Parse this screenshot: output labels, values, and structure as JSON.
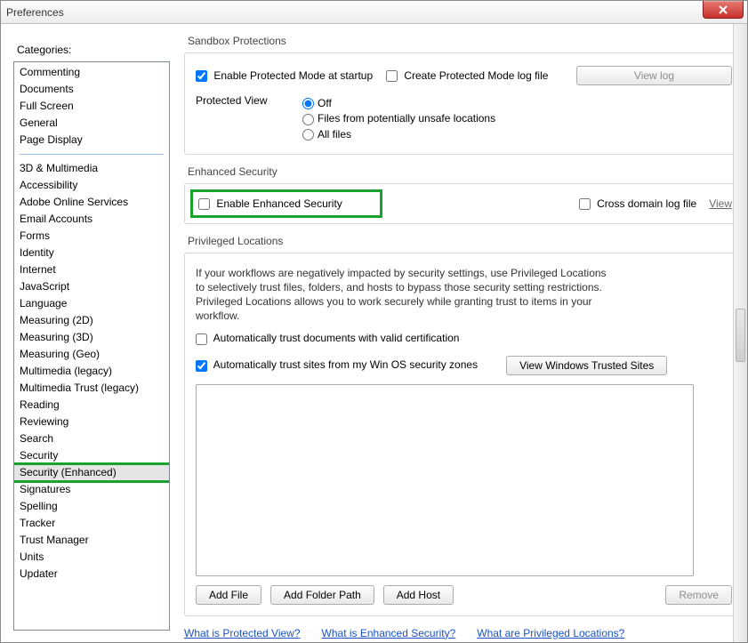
{
  "window": {
    "title": "Preferences"
  },
  "categories_label": "Categories:",
  "categories_top": [
    "Commenting",
    "Documents",
    "Full Screen",
    "General",
    "Page Display"
  ],
  "categories_rest": [
    "3D & Multimedia",
    "Accessibility",
    "Adobe Online Services",
    "Email Accounts",
    "Forms",
    "Identity",
    "Internet",
    "JavaScript",
    "Language",
    "Measuring (2D)",
    "Measuring (3D)",
    "Measuring (Geo)",
    "Multimedia (legacy)",
    "Multimedia Trust (legacy)",
    "Reading",
    "Reviewing",
    "Search",
    "Security",
    "Security (Enhanced)",
    "Signatures",
    "Spelling",
    "Tracker",
    "Trust Manager",
    "Units",
    "Updater"
  ],
  "selected_category": "Security (Enhanced)",
  "sandbox": {
    "title": "Sandbox Protections",
    "enable_protected_mode": "Enable Protected Mode at startup",
    "create_log": "Create Protected Mode log file",
    "view_log": "View log",
    "protected_view_label": "Protected View",
    "off": "Off",
    "unsafe": "Files from potentially unsafe locations",
    "all": "All files"
  },
  "enhanced": {
    "title": "Enhanced Security",
    "enable": "Enable Enhanced Security",
    "cross_domain": "Cross domain log file",
    "view": "View"
  },
  "privileged": {
    "title": "Privileged Locations",
    "desc": "If your workflows are negatively impacted by security settings, use Privileged Locations to selectively trust files, folders, and hosts to bypass those security setting restrictions. Privileged Locations allows you to work securely while granting trust to items in your workflow.",
    "auto_trust_cert": "Automatically trust documents with valid certification",
    "auto_trust_os": "Automatically trust sites from my Win OS security zones",
    "view_trusted": "View Windows Trusted Sites",
    "add_file": "Add File",
    "add_folder": "Add Folder Path",
    "add_host": "Add Host",
    "remove": "Remove"
  },
  "footer": {
    "what_pv": "What is Protected View?",
    "what_es": "What is Enhanced Security?",
    "what_pl": "What are Privileged Locations?"
  }
}
